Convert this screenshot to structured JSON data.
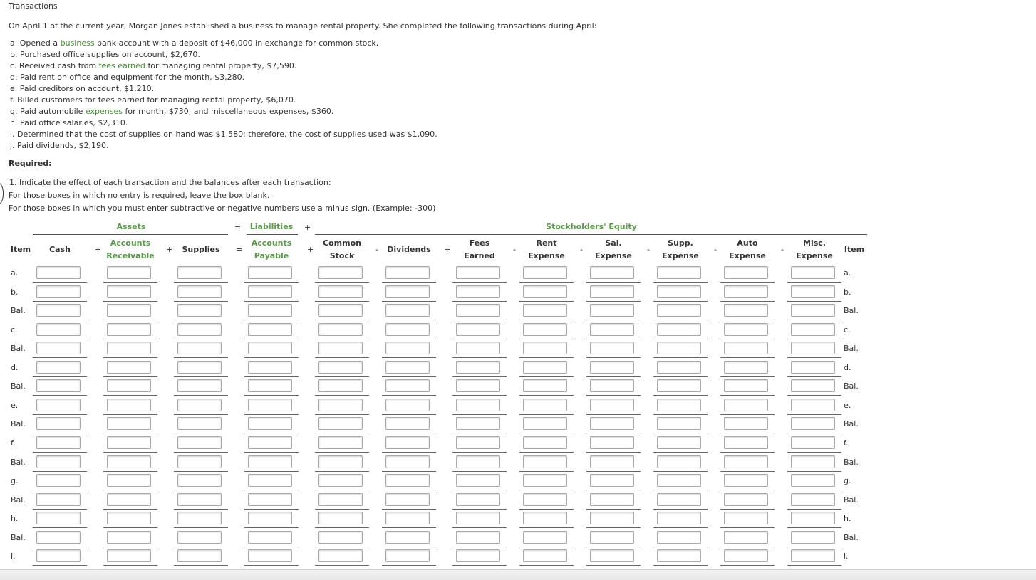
{
  "page": {
    "title": "Transactions",
    "intro": "On April 1 of the current year, Morgan Jones established a business to manage rental property. She completed the following transactions during April:"
  },
  "transactions": [
    {
      "pre": "a. Opened a ",
      "link": "business",
      "post": " bank account with a deposit of $46,000 in exchange for common stock."
    },
    {
      "pre": "b. Purchased office supplies on account, $2,670.",
      "link": "",
      "post": ""
    },
    {
      "pre": "c. Received cash from ",
      "link": "fees earned",
      "post": " for managing rental property, $7,590."
    },
    {
      "pre": "d. Paid rent on office and equipment for the month, $3,280.",
      "link": "",
      "post": ""
    },
    {
      "pre": "e. Paid creditors on account, $1,210.",
      "link": "",
      "post": ""
    },
    {
      "pre": "f. Billed customers for fees earned for managing rental property, $6,070.",
      "link": "",
      "post": ""
    },
    {
      "pre": "g. Paid automobile ",
      "link": "expenses",
      "post": " for month, $730, and miscellaneous expenses, $360."
    },
    {
      "pre": "h. Paid office salaries, $2,310.",
      "link": "",
      "post": ""
    },
    {
      "pre": "i. Determined that the cost of supplies on hand was $1,580; therefore, the cost of supplies used was $1,090.",
      "link": "",
      "post": ""
    },
    {
      "pre": "j. Paid dividends, $2,190.",
      "link": "",
      "post": ""
    }
  ],
  "required": {
    "label": "Required:",
    "step": "1.",
    "step_text": " Indicate the effect of each transaction and the balances after each transaction:",
    "line2": "For those boxes in which no entry is required, leave the box blank.",
    "line3": "For those boxes in which you must enter subtractive or negative numbers use a minus sign. (Example: -300)"
  },
  "table": {
    "group_assets": "Assets",
    "group_liabilities": "Liabilities",
    "group_equity": "Stockholders' Equity",
    "item_header": "Item",
    "columns": [
      {
        "l1": "",
        "l2": "Cash",
        "green": false
      },
      {
        "l1": "Accounts",
        "l2": "Receivable",
        "green": true
      },
      {
        "l1": "",
        "l2": "Supplies",
        "green": false
      },
      {
        "l1": "Accounts",
        "l2": "Payable",
        "green": true
      },
      {
        "l1": "Common",
        "l2": "Stock",
        "green": false
      },
      {
        "l1": "",
        "l2": "Dividends",
        "green": false
      },
      {
        "l1": "Fees",
        "l2": "Earned",
        "green": false
      },
      {
        "l1": "Rent",
        "l2": "Expense",
        "green": false
      },
      {
        "l1": "Sal.",
        "l2": "Expense",
        "green": false
      },
      {
        "l1": "Supp.",
        "l2": "Expense",
        "green": false
      },
      {
        "l1": "Auto",
        "l2": "Expense",
        "green": false
      },
      {
        "l1": "Misc.",
        "l2": "Expense",
        "green": false
      }
    ],
    "operators": {
      "eq_top": "=",
      "plus_top": "+",
      "hdr": [
        "+",
        "+",
        "=",
        "+",
        "-",
        "+",
        "-",
        "-",
        "-",
        "-",
        "-"
      ]
    },
    "rows": [
      "a.",
      "b.",
      "Bal.",
      "c.",
      "Bal.",
      "d.",
      "Bal.",
      "e.",
      "Bal.",
      "f.",
      "Bal.",
      "g.",
      "Bal.",
      "h.",
      "Bal.",
      "i."
    ]
  }
}
